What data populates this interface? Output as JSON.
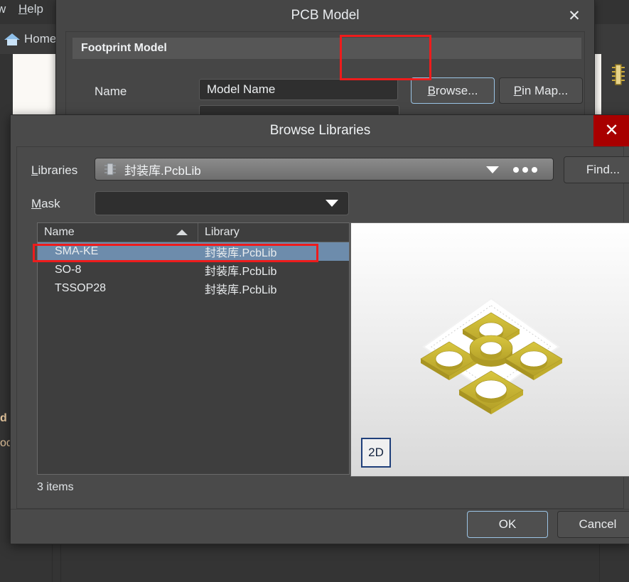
{
  "background_app": {
    "menu_items": [
      {
        "prefix": "w",
        "label": "w"
      },
      {
        "accel": "H",
        "rest": "elp",
        "label": "Help"
      }
    ],
    "menu_partial_label": "w",
    "help_accel": "H",
    "help_rest": "elp",
    "tab_label": "Home",
    "home_icon": "home-icon",
    "chip_icon": "chip-icon",
    "left_clip_texts": [
      "d",
      "od"
    ]
  },
  "pcb_model_dialog": {
    "title": "PCB Model",
    "close_icon": "close-icon",
    "close_glyph": "✕",
    "group_header": "Footprint Model",
    "name_label": "Name",
    "name_value": "Model Name",
    "name_placeholder": "Model Name",
    "browse_accel": "B",
    "browse_rest": "rowse...",
    "browse_label": "Browse...",
    "pinmap_accel": "P",
    "pinmap_rest": "in Map...",
    "pinmap_label": "Pin Map..."
  },
  "browse_libraries_dialog": {
    "title": "Browse Libraries",
    "close_icon": "close-icon",
    "close_glyph": "✕",
    "libraries_accel": "L",
    "libraries_rest": "ibraries",
    "libraries_label": "Libraries",
    "libraries_value": "封装库.PcbLib",
    "library_icon": "chip-icon",
    "dropdown_icon": "chevron-down-icon",
    "ellipsis_icon": "ellipsis-icon",
    "find_label": "Find...",
    "mask_accel": "M",
    "mask_rest": "ask",
    "mask_label": "Mask",
    "mask_value": "",
    "mask_placeholder": "",
    "columns": [
      "Name",
      "Library"
    ],
    "sort_icon": "sort-ascending-icon",
    "rows": [
      {
        "name": "SMA-KE",
        "library": "封装库.PcbLib",
        "selected": true
      },
      {
        "name": "SO-8",
        "library": "封装库.PcbLib",
        "selected": false
      },
      {
        "name": "TSSOP28",
        "library": "封装库.PcbLib",
        "selected": false
      }
    ],
    "items_count": "3 items",
    "preview": {
      "view_mode_label": "2D",
      "pad_color": "#c9b430",
      "board_color": "#ffffff",
      "pads": [
        {
          "shape": "square",
          "position": "top"
        },
        {
          "shape": "square",
          "position": "left"
        },
        {
          "shape": "round",
          "position": "center"
        },
        {
          "shape": "square",
          "position": "right"
        },
        {
          "shape": "square",
          "position": "bottom"
        }
      ]
    },
    "ok_label": "OK",
    "cancel_label": "Cancel"
  },
  "annotations": {
    "highlight_color": "#ee1c1c",
    "boxes": [
      "browse-button",
      "selected-row"
    ]
  },
  "colors": {
    "dialog_bg": "#4a4a4a",
    "selection_blue": "#6d8cac",
    "close_red": "#a80000",
    "focus_border": "#9bc4e5",
    "annotation_red": "#ee1c1c"
  }
}
